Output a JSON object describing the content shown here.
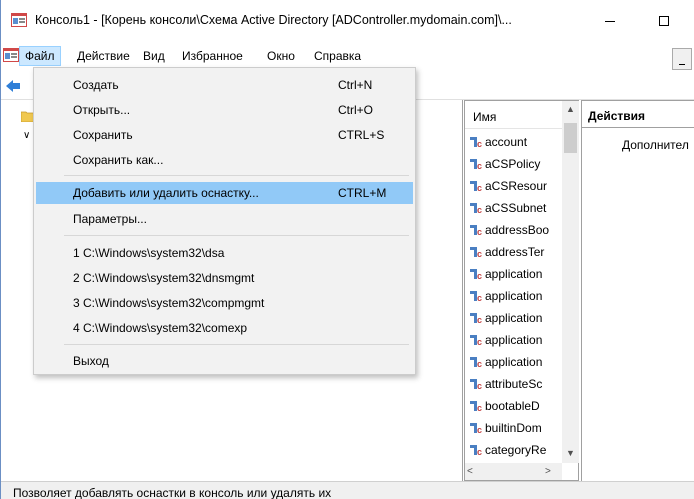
{
  "window": {
    "title": "Консоль1 - [Корень консоли\\Схема Active Directory [ADController.mydomain.com]\\..."
  },
  "menubar": {
    "items": [
      "Файл",
      "Действие",
      "Вид",
      "Избранное",
      "Окно",
      "Справка"
    ]
  },
  "file_menu": {
    "items": [
      {
        "label": "Создать",
        "shortcut": "Ctrl+N"
      },
      {
        "label": "Открыть...",
        "shortcut": "Ctrl+O"
      },
      {
        "label": "Сохранить",
        "shortcut": "CTRL+S"
      },
      {
        "label": "Сохранить как...",
        "shortcut": ""
      },
      {
        "label": "Добавить или удалить оснастку...",
        "shortcut": "CTRL+M"
      },
      {
        "label": "Параметры...",
        "shortcut": ""
      },
      {
        "label": "1 C:\\Windows\\system32\\dsa",
        "shortcut": ""
      },
      {
        "label": "2 C:\\Windows\\system32\\dnsmgmt",
        "shortcut": ""
      },
      {
        "label": "3 C:\\Windows\\system32\\compmgmt",
        "shortcut": ""
      },
      {
        "label": "4 C:\\Windows\\system32\\comexp",
        "shortcut": ""
      },
      {
        "label": "Выход",
        "shortcut": ""
      }
    ],
    "highlighted": "Добавить или удалить оснастку..."
  },
  "list": {
    "column_header": "Имя",
    "rows": [
      "account",
      "aCSPolicy",
      "aCSResour",
      "aCSSubnet",
      "addressBoo",
      "addressTer",
      "application",
      "application",
      "application",
      "application",
      "application",
      "attributeSc",
      "bootableD",
      "builtinDom",
      "categoryRe"
    ]
  },
  "actions": {
    "header": "Действия",
    "item": "Дополнител"
  },
  "statusbar": {
    "text": "Позволяет добавлять оснастки в консоль или удалять их"
  }
}
